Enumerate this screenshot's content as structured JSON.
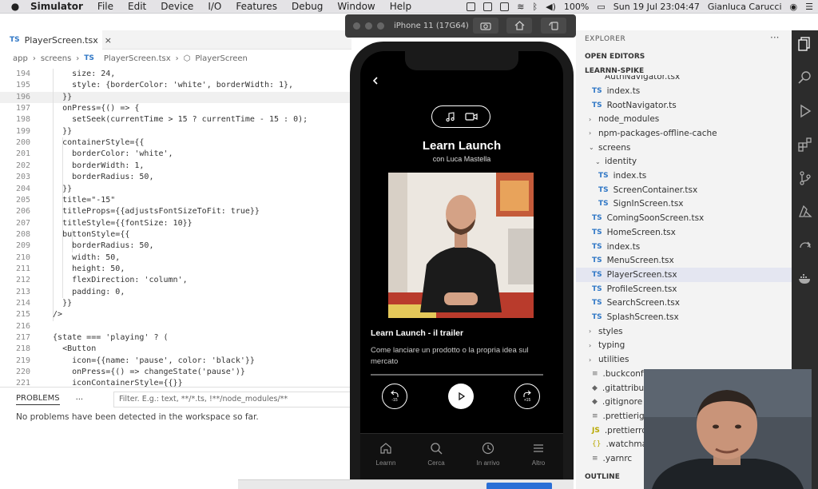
{
  "menubar": {
    "app_name": "Simulator",
    "items": [
      "File",
      "Edit",
      "Device",
      "I/O",
      "Features",
      "Debug",
      "Window",
      "Help"
    ],
    "battery": "100%",
    "datetime": "Sun 19 Jul  23:04:47",
    "user": "Gianluca Carucci"
  },
  "editor": {
    "tab_label": "PlayerScreen.tsx",
    "tab_badge": "TS",
    "close_glyph": "×",
    "breadcrumb": [
      "app",
      "screens",
      "PlayerScreen.tsx",
      "PlayerScreen"
    ],
    "breadcrumb_sep": "›",
    "line_numbers": [
      "194",
      "195",
      "196",
      "197",
      "198",
      "199",
      "200",
      "201",
      "202",
      "203",
      "204",
      "205",
      "206",
      "207",
      "208",
      "209",
      "210",
      "211",
      "212",
      "213",
      "214",
      "215",
      "216",
      "217",
      "218",
      "219",
      "220",
      "221"
    ],
    "lines": [
      "      size: 24,",
      "      style: {borderColor: 'white', borderWidth: 1},",
      "    }}",
      "    onPress={() => {",
      "      setSeek(currentTime > 15 ? currentTime - 15 : 0);",
      "    }}",
      "    containerStyle={{",
      "      borderColor: 'white',",
      "      borderWidth: 1,",
      "      borderRadius: 50,",
      "    }}",
      "    title=\"-15\"",
      "    titleProps={{adjustsFontSizeToFit: true}}",
      "    titleStyle={{fontSize: 10}}",
      "    buttonStyle={{",
      "      borderRadius: 50,",
      "      width: 50,",
      "      height: 50,",
      "      flexDirection: 'column',",
      "      padding: 0,",
      "    }}",
      "  />",
      "",
      "  {state === 'playing' ? (",
      "    <Button",
      "      icon={{name: 'pause', color: 'black'}}",
      "      onPress={() => changeState('pause')}",
      "      iconContainerStyle={{}}"
    ]
  },
  "problems": {
    "tab": "PROBLEMS",
    "more": "···",
    "filter_placeholder": "Filter. E.g.: text, **/*.ts, !**/node_modules/**",
    "message": "No problems have been detected in the workspace so far."
  },
  "simulator": {
    "device_title": "iPhone 11 (17G64)"
  },
  "app": {
    "title": "Learn Launch",
    "subtitle": "con Luca Mastella",
    "episode_title": "Learn Launch - il trailer",
    "episode_desc": "Come lanciare un prodotto o la propria idea sul mercato",
    "progress": 0,
    "rewind_label": "-15",
    "forward_label": "+15",
    "nav": [
      "Learnn",
      "Cerca",
      "In arrivo",
      "Altro"
    ]
  },
  "explorer": {
    "header": "EXPLORER",
    "more": "···",
    "open_editors": "OPEN EDITORS",
    "project": "LEARNN-SPIKE",
    "cut_item": "AuthNavigator.tsx",
    "items": [
      {
        "label": "index.ts",
        "icon": "TS"
      },
      {
        "label": "RootNavigator.ts",
        "icon": "TS"
      },
      {
        "label": "node_modules",
        "icon": ""
      },
      {
        "label": "npm-packages-offline-cache",
        "icon": ""
      },
      {
        "label": "screens",
        "icon": ""
      },
      {
        "label": "identity",
        "icon": ""
      },
      {
        "label": "index.ts",
        "icon": "TS"
      },
      {
        "label": "ScreenContainer.tsx",
        "icon": "TS"
      },
      {
        "label": "SignInScreen.tsx",
        "icon": "TS"
      },
      {
        "label": "ComingSoonScreen.tsx",
        "icon": "TS"
      },
      {
        "label": "HomeScreen.tsx",
        "icon": "TS"
      },
      {
        "label": "index.ts",
        "icon": "TS"
      },
      {
        "label": "MenuScreen.tsx",
        "icon": "TS"
      },
      {
        "label": "PlayerScreen.tsx",
        "icon": "TS"
      },
      {
        "label": "ProfileScreen.tsx",
        "icon": "TS"
      },
      {
        "label": "SearchScreen.tsx",
        "icon": "TS"
      },
      {
        "label": "SplashScreen.tsx",
        "icon": "TS"
      },
      {
        "label": "styles",
        "icon": ""
      },
      {
        "label": "typing",
        "icon": ""
      },
      {
        "label": "utilities",
        "icon": ""
      },
      {
        "label": ".buckconfig",
        "icon": "≡"
      },
      {
        "label": ".gitattributes",
        "icon": "◆"
      },
      {
        "label": ".gitignore",
        "icon": "◆"
      },
      {
        "label": ".prettierignore",
        "icon": "≡"
      },
      {
        "label": ".prettierrc.js",
        "icon": "JS"
      },
      {
        "label": ".watchmanconfig",
        "icon": "{}"
      },
      {
        "label": ".yarnrc",
        "icon": "≡"
      }
    ],
    "outline": "OUTLINE"
  },
  "colors": {
    "accent_blue": "#3178c6",
    "selection": "#e4e6f1",
    "app_bg": "#000000"
  }
}
